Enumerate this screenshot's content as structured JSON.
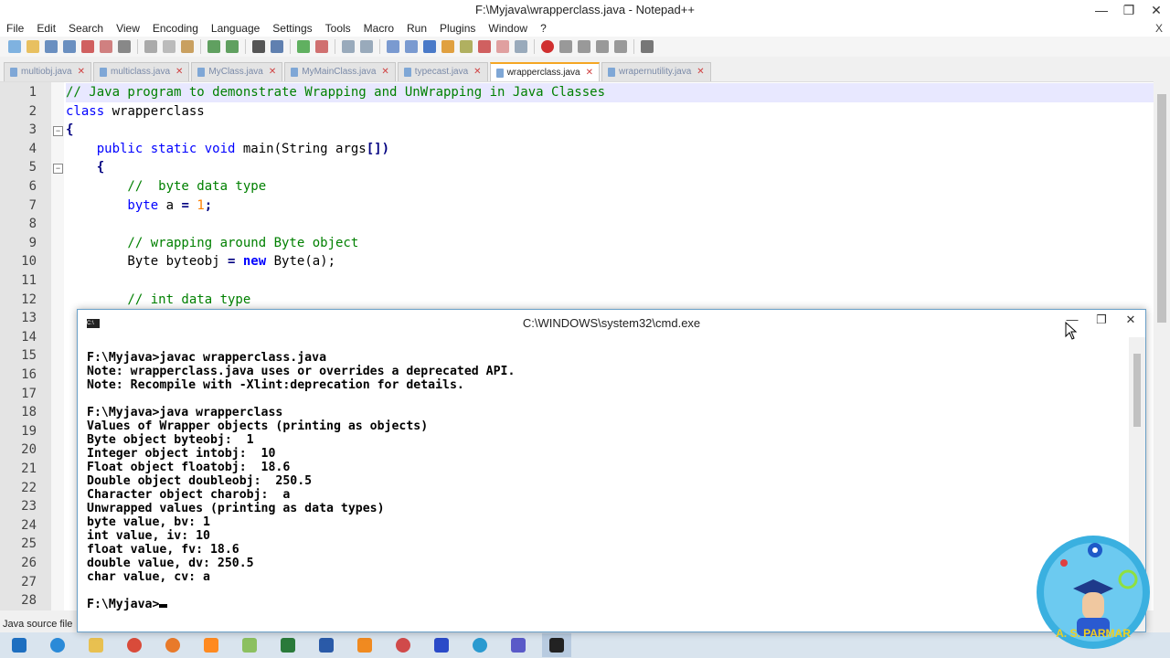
{
  "notepad": {
    "title": "F:\\Myjava\\wrapperclass.java - Notepad++",
    "caption_buttons": [
      "—",
      "❐",
      "✕"
    ],
    "menu": [
      "File",
      "Edit",
      "Search",
      "View",
      "Encoding",
      "Language",
      "Settings",
      "Tools",
      "Macro",
      "Run",
      "Plugins",
      "Window",
      "?"
    ],
    "menu_close": "X",
    "tabs": [
      {
        "label": "multiobj.java",
        "active": false
      },
      {
        "label": "multiclass.java",
        "active": false
      },
      {
        "label": "MyClass.java",
        "active": false
      },
      {
        "label": "MyMainClass.java",
        "active": false
      },
      {
        "label": "typecast.java",
        "active": false
      },
      {
        "label": "wrapperclass.java",
        "active": true
      },
      {
        "label": "wrapernutility.java",
        "active": false
      }
    ],
    "line_numbers": [
      "1",
      "2",
      "3",
      "4",
      "5",
      "6",
      "7",
      "8",
      "9",
      "10",
      "11",
      "12",
      "13",
      "14",
      "15",
      "16",
      "17",
      "18",
      "19",
      "20",
      "21",
      "22",
      "23",
      "24",
      "25",
      "26",
      "27",
      "28"
    ],
    "code": {
      "l1": "// Java program to demonstrate Wrapping and UnWrapping in Java Classes",
      "l2a": "class",
      "l2b": " wrapperclass",
      "l3": "{",
      "l4a": "    public static void",
      "l4b": " main(String args",
      "l4c": "[])",
      "l5": "    {",
      "l6": "        //  byte data type",
      "l7a": "        byte",
      "l7b": " a ",
      "l7c": "=",
      "l7d": " 1",
      "l7e": ";",
      "l9": "        // wrapping around Byte object",
      "l10a": "        Byte byteobj ",
      "l10b": "=",
      "l10c": " new",
      "l10d": " Byte(a);",
      "l12": "        // int data type"
    },
    "status": "Java source file"
  },
  "cmd": {
    "title": "C:\\WINDOWS\\system32\\cmd.exe",
    "caption_buttons": [
      "—",
      "❐",
      "✕"
    ],
    "lines": [
      "F:\\Myjava>javac wrapperclass.java",
      "Note: wrapperclass.java uses or overrides a deprecated API.",
      "Note: Recompile with -Xlint:deprecation for details.",
      "",
      "F:\\Myjava>java wrapperclass",
      "Values of Wrapper objects (printing as objects)",
      "Byte object byteobj:  1",
      "Integer object intobj:  10",
      "Float object floatobj:  18.6",
      "Double object doubleobj:  250.5",
      "Character object charobj:  a",
      "Unwrapped values (printing as data types)",
      "byte value, bv: 1",
      "int value, iv: 10",
      "float value, fv: 18.6",
      "double value, dv: 250.5",
      "char value, cv: a",
      "",
      "F:\\Myjava>"
    ]
  },
  "logo": {
    "text": "A. S. PARMAR"
  },
  "taskbar": {
    "icons": [
      "windows-start-icon",
      "ie-icon",
      "file-explorer-icon",
      "chrome-icon",
      "firefox-icon",
      "sublime-icon",
      "notepadpp-icon",
      "app-icon",
      "word-icon",
      "vlc-icon",
      "media-icon",
      "app-icon-2",
      "edge-icon",
      "teams-icon",
      "cmd-icon"
    ]
  },
  "colors": {
    "accent_tab": "#f5a623",
    "comment": "#008000",
    "keyword": "#0000ff",
    "number": "#ff8000"
  }
}
